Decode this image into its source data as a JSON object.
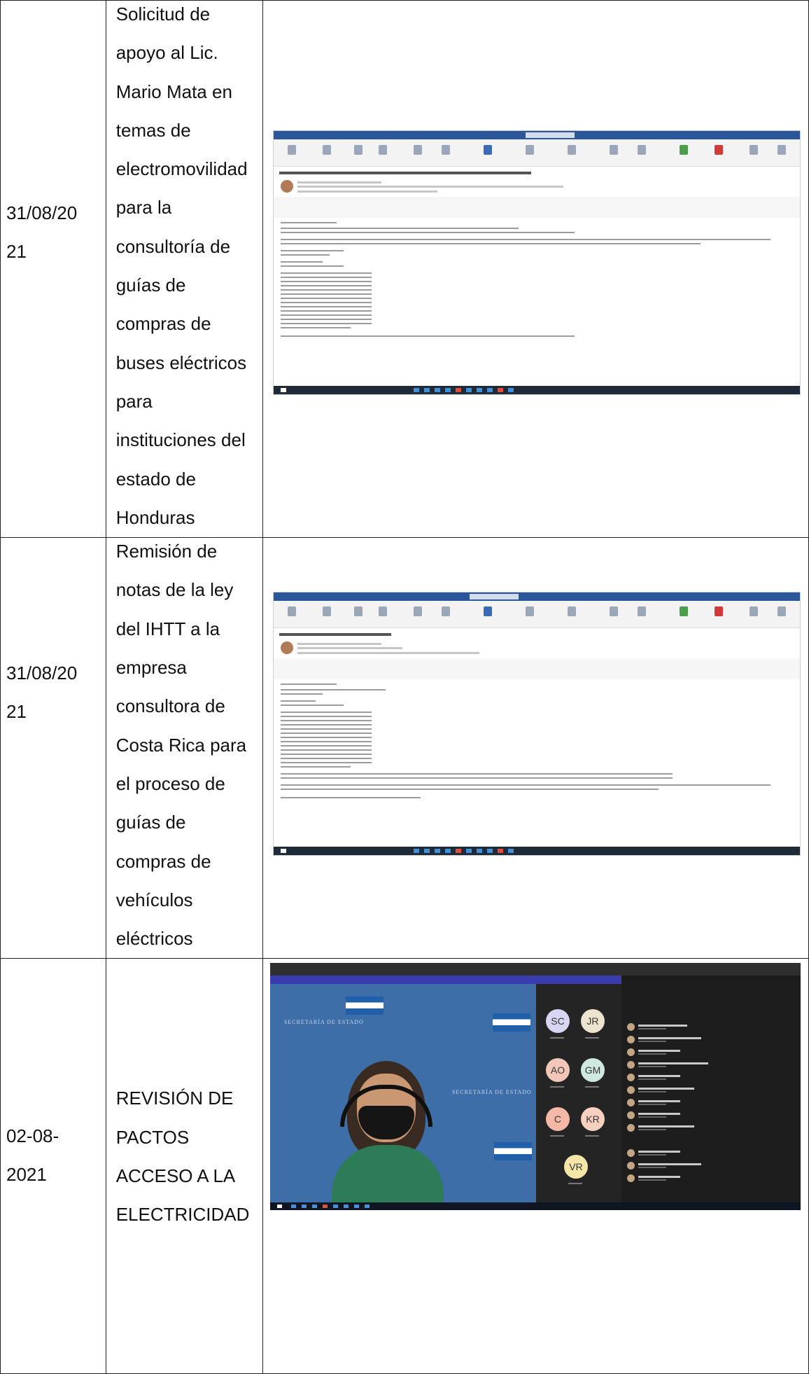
{
  "rows": [
    {
      "date": "31/08/2021",
      "description_lines": [
        "Solicitud de",
        "apoyo al Lic.",
        "Mario Mata en",
        "temas de",
        "electromovilidad",
        "para la",
        "consultoría de",
        "guías de",
        "compras de",
        "buses eléctricos",
        "para",
        "instituciones del",
        "estado de",
        "Honduras"
      ],
      "evidence_type": "email-screenshot"
    },
    {
      "date": "31/08/2021",
      "description_lines": [
        "Remisión de",
        "notas de la ley",
        "del IHTT a la",
        "empresa",
        "consultora de",
        "Costa Rica para",
        "el proceso de",
        "guías de",
        "compras de",
        "vehículos",
        "eléctricos"
      ],
      "evidence_type": "email-screenshot"
    },
    {
      "date": "02-08-2021",
      "description_lines": [
        "REVISIÓN DE",
        "PACTOS",
        "ACCESO A LA",
        "ELECTRICIDAD"
      ],
      "evidence_type": "video-call-screenshot",
      "meeting_tiles": [
        {
          "initials": "SC",
          "color": "#d6d6f2"
        },
        {
          "initials": "JR",
          "color": "#ece4cf"
        },
        {
          "initials": "AO",
          "color": "#f2c6b9"
        },
        {
          "initials": "GM",
          "color": "#cfe9e0"
        },
        {
          "initials": "C",
          "color": "#f5b7a6"
        },
        {
          "initials": "KR",
          "color": "#f7d0bf"
        },
        {
          "initials": "VR",
          "color": "#f5e6a8"
        }
      ]
    }
  ]
}
